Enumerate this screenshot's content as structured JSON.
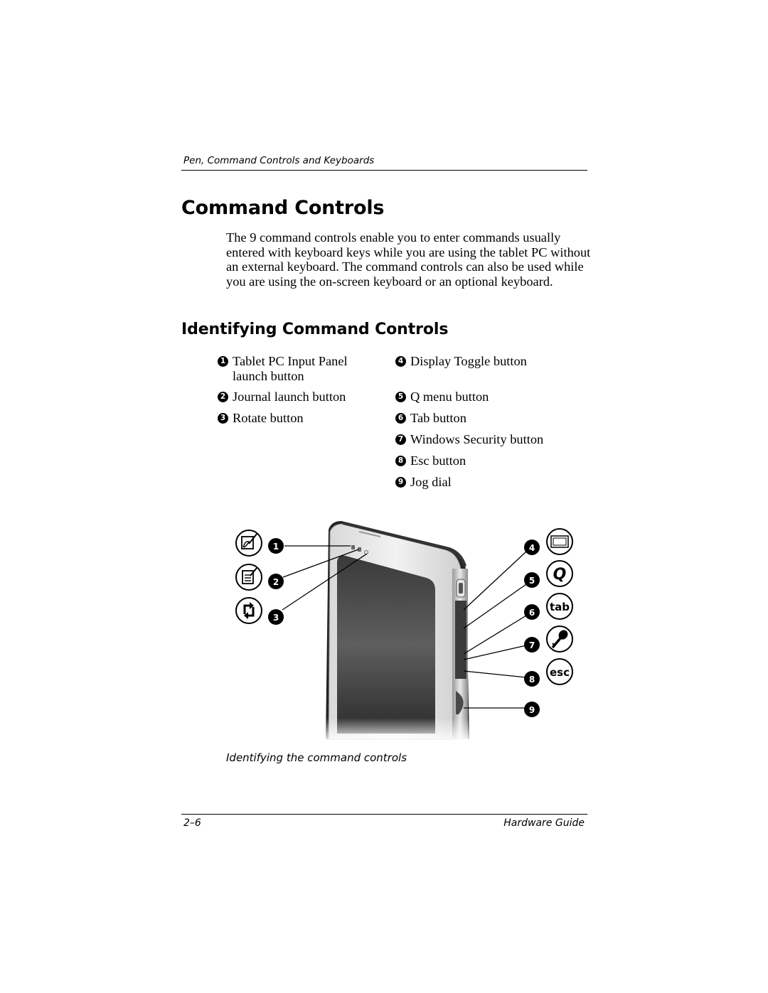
{
  "running_head": "Pen, Command Controls and Keyboards",
  "title": "Command Controls",
  "intro": "The 9 command controls enable you to enter commands usually entered with keyboard keys while you are using the tablet PC without an external keyboard. The command controls can also be used while you are using the on-screen keyboard or an optional keyboard.",
  "section_heading": "Identifying Command Controls",
  "items": [
    {
      "number": "1",
      "label": "Tablet PC Input Panel launch button",
      "icon": "input-panel-icon"
    },
    {
      "number": "2",
      "label": "Journal launch button",
      "icon": "journal-icon"
    },
    {
      "number": "3",
      "label": "Rotate button",
      "icon": "rotate-icon"
    },
    {
      "number": "4",
      "label": "Display Toggle button",
      "icon": "display-toggle-icon"
    },
    {
      "number": "5",
      "label": "Q menu button",
      "icon": "q-menu-icon"
    },
    {
      "number": "6",
      "label": "Tab button",
      "icon": "tab-icon"
    },
    {
      "number": "7",
      "label": "Windows Security button",
      "icon": "key-icon"
    },
    {
      "number": "8",
      "label": "Esc button",
      "icon": "esc-icon"
    },
    {
      "number": "9",
      "label": "Jog dial",
      "icon": null
    }
  ],
  "figure": {
    "caption": "Identifying the command controls",
    "icon_text": {
      "q": "Q",
      "tab": "tab",
      "esc": "esc"
    }
  },
  "footer": {
    "page_number": "2–6",
    "book_title": "Hardware Guide"
  }
}
